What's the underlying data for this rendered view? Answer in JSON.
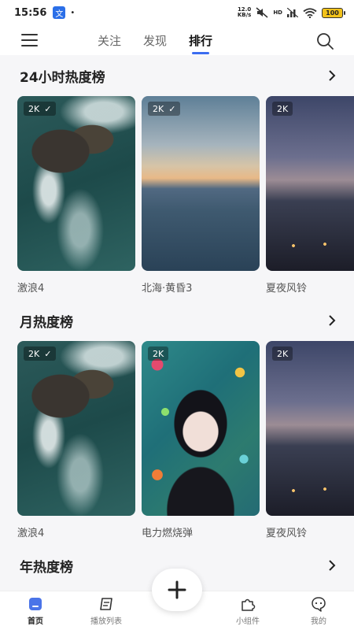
{
  "status_bar": {
    "time": "15:56",
    "app_badge": "文",
    "dot": "•",
    "net_speed_value": "12.0",
    "net_speed_unit": "KB/s",
    "hd_label": "HD",
    "battery": "100"
  },
  "top_nav": {
    "tabs": [
      {
        "label": "关注",
        "active": false
      },
      {
        "label": "发现",
        "active": false
      },
      {
        "label": "排行",
        "active": true
      }
    ],
    "accent_color": "#3c6cf0"
  },
  "sections": [
    {
      "title": "24小时热度榜",
      "cards": [
        {
          "caption": "激浪4",
          "badge": "2K",
          "checked": true,
          "art": "wave"
        },
        {
          "caption": "北海·黄昏3",
          "badge": "2K",
          "checked": true,
          "art": "sunset"
        },
        {
          "caption": "夏夜风铃",
          "badge": "2K",
          "checked": false,
          "art": "night"
        }
      ]
    },
    {
      "title": "月热度榜",
      "cards": [
        {
          "caption": "激浪4",
          "badge": "2K",
          "checked": true,
          "art": "wave"
        },
        {
          "caption": "电力燃烧弹",
          "badge": "2K",
          "checked": false,
          "art": "anime"
        },
        {
          "caption": "夏夜风铃",
          "badge": "2K",
          "checked": false,
          "art": "night"
        }
      ]
    },
    {
      "title": "年热度榜",
      "cards": []
    }
  ],
  "bottom_nav": {
    "items": [
      {
        "label": "首页",
        "icon": "home-icon",
        "active": true
      },
      {
        "label": "播放列表",
        "icon": "playlist-icon",
        "active": false
      },
      {
        "label": "小组件",
        "icon": "widget-icon",
        "active": false
      },
      {
        "label": "我的",
        "icon": "profile-icon",
        "active": false
      }
    ],
    "fab_icon": "plus-icon"
  }
}
